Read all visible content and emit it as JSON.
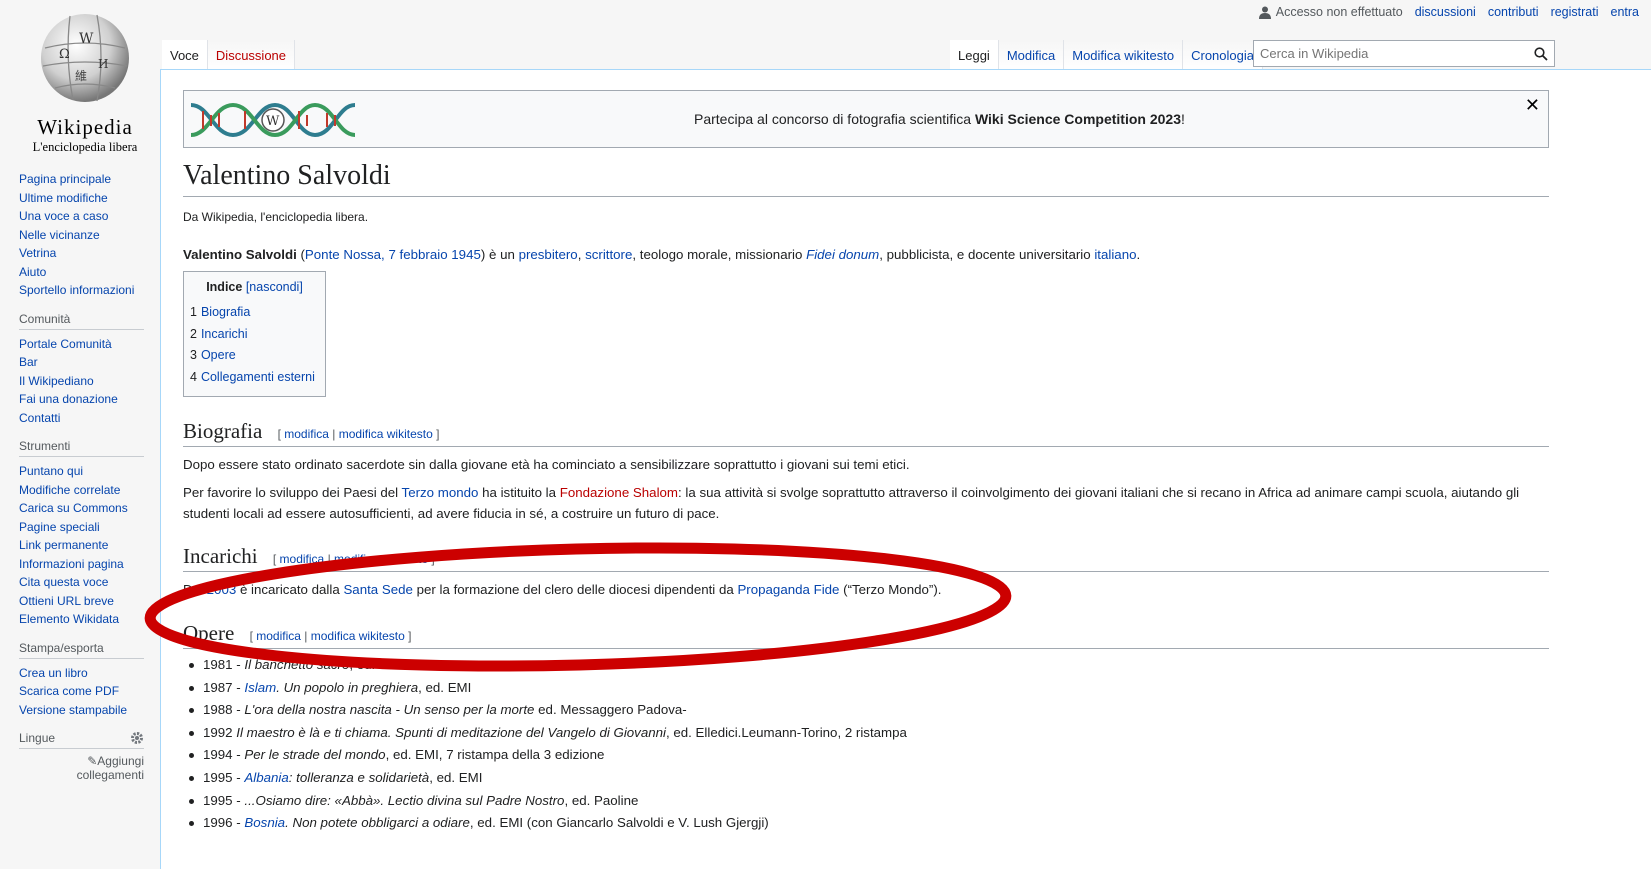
{
  "personal": {
    "anon": "Accesso non effettuato",
    "links": [
      "discussioni",
      "contributi",
      "registrati",
      "entra"
    ]
  },
  "logo": {
    "wordmark": "Wikipedia",
    "tagline": "L'enciclopedia libera"
  },
  "sidebar": {
    "nav": [
      "Pagina principale",
      "Ultime modifiche",
      "Una voce a caso",
      "Nelle vicinanze",
      "Vetrina",
      "Aiuto",
      "Sportello informazioni"
    ],
    "community": {
      "heading": "Comunità",
      "items": [
        "Portale Comunità",
        "Bar",
        "Il Wikipediano",
        "Fai una donazione",
        "Contatti"
      ]
    },
    "tools": {
      "heading": "Strumenti",
      "items": [
        "Puntano qui",
        "Modifiche correlate",
        "Carica su Commons",
        "Pagine speciali",
        "Link permanente",
        "Informazioni pagina",
        "Cita questa voce",
        "Ottieni URL breve",
        "Elemento Wikidata"
      ]
    },
    "print": {
      "heading": "Stampa/esporta",
      "items": [
        "Crea un libro",
        "Scarica come PDF",
        "Versione stampabile"
      ]
    },
    "lang": {
      "heading": "Lingue",
      "add": "Aggiungi collegamenti"
    }
  },
  "tabs": {
    "left": [
      "Voce",
      "Discussione"
    ],
    "right": [
      "Leggi",
      "Modifica",
      "Modifica wikitesto",
      "Cronologia"
    ]
  },
  "search": {
    "placeholder": "Cerca in Wikipedia"
  },
  "banner": {
    "text": "Partecipa al concorso di fotografia scientifica ",
    "bold": "Wiki Science Competition 2023",
    "end": "!",
    "close": "✕"
  },
  "article": {
    "title": "Valentino Salvoldi",
    "tagline": "Da Wikipedia, l'enciclopedia libera.",
    "intro": {
      "name": "Valentino Salvoldi",
      "p1": " (",
      "place": "Ponte Nossa, 7 febbraio 1945",
      "p2": ") è un ",
      "l1": "presbitero",
      "c1": ", ",
      "l2": "scrittore",
      "p3": ", teologo morale, missionario ",
      "l3": "Fidei donum",
      "p4": ", pubblicista, e docente universitario ",
      "l4": "italiano",
      "p5": "."
    },
    "toc": {
      "title": "Indice",
      "toggle": "[nascondi]",
      "items": [
        {
          "num": "1",
          "label": "Biografia"
        },
        {
          "num": "2",
          "label": "Incarichi"
        },
        {
          "num": "3",
          "label": "Opere"
        },
        {
          "num": "4",
          "label": "Collegamenti esterni"
        }
      ]
    },
    "edit": {
      "open": "[ ",
      "edit": "modifica",
      "sep": " | ",
      "wiki": "modifica wikitesto",
      "close": " ]"
    },
    "bio": {
      "heading": "Biografia",
      "p1": "Dopo essere stato ordinato sacerdote sin dalla giovane età ha cominciato a sensibilizzare soprattutto i giovani sui temi etici.",
      "p2a": "Per favorire lo sviluppo dei Paesi del ",
      "p2l1": "Terzo mondo",
      "p2b": " ha istituito la ",
      "p2l2": "Fondazione Shalom",
      "p2c": ": la sua attività si svolge soprattutto attraverso il coinvolgimento dei giovani italiani che si recano in Africa ad animare campi scuola, aiutando gli studenti locali ad essere autosufficienti, ad avere fiducia in sé, a costruire un futuro di pace."
    },
    "roles": {
      "heading": "Incarichi",
      "a": "Dal ",
      "l1": "2003",
      "b": " è incaricato dalla ",
      "l2": "Santa Sede",
      "c": " per la formazione del clero delle diocesi dipendenti da ",
      "l3": "Propaganda Fide",
      "d": " (“Terzo Mondo”)."
    },
    "works": {
      "heading": "Opere",
      "items": [
        [
          "1981 - ",
          "Il banchetto sacro",
          ", ed. EMI"
        ],
        [
          "1987 - ",
          "Islam",
          ". Un popolo in preghiera",
          ", ed. EMI"
        ],
        [
          "1988 - ",
          "L'ora della nostra nascita - Un senso per la morte",
          " ed. Messaggero Padova-"
        ],
        [
          "1992 ",
          "Il maestro è là e ti chiama. Spunti di meditazione del Vangelo di Giovanni",
          ", ed. Elledici.Leumann-Torino, 2 ristampa"
        ],
        [
          "1994 - ",
          "Per le strade del mondo",
          ", ed. EMI, 7 ristampa della 3 edizione"
        ],
        [
          "1995 - ",
          "Albania",
          ": tolleranza e solidarietà",
          ", ed. EMI"
        ],
        [
          "1995 - ",
          "...Osiamo dire: «Abbà». Lectio divina sul Padre Nostro",
          ", ed. Paoline"
        ],
        [
          "1996 - ",
          "Bosnia",
          ". Non potete obbligarci a odiare",
          ", ed. EMI (con Giancarlo Salvoldi e V. Lush Gjergji)"
        ]
      ]
    }
  },
  "colors": {
    "link": "#0645ad",
    "redlink": "#ba0000",
    "annotation": "#cc0000"
  }
}
